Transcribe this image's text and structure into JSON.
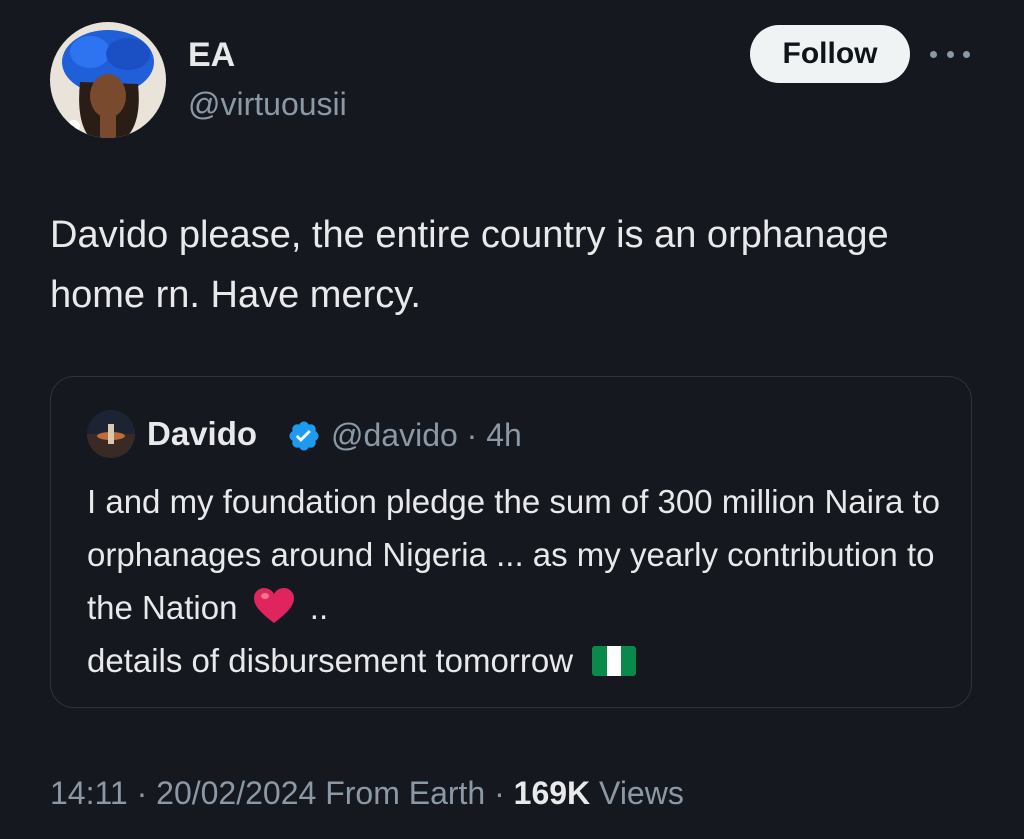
{
  "author": {
    "display_name": "EA",
    "handle": "@virtuousii",
    "follow_label": "Follow"
  },
  "tweet": {
    "text": "Davido please, the entire country is an orphanage home rn. Have mercy."
  },
  "quoted_tweet": {
    "display_name": "Davido",
    "handle_time": "@davido · 4h",
    "text_part1": "I and my foundation pledge the sum of 300 million Naira  to orphanages around Nigeria ... as my yearly contribution to the Nation",
    "text_part2": "..",
    "text_part3": "details of disbursement tomorrow"
  },
  "meta": {
    "timestamp": "14:11 · 20/02/2024 From Earth ·",
    "views_count": "169K",
    "views_label": "Views"
  },
  "colors": {
    "background": "#16181f",
    "text_primary": "#e7e9ea",
    "text_secondary": "#8b98a5",
    "verified_blue": "#1d9bf0",
    "heart_red": "#e0245e"
  },
  "icons": {
    "more": "more-horizontal-icon",
    "verified": "verified-badge-icon",
    "heart": "red-heart-emoji",
    "flag": "nigeria-flag-emoji"
  }
}
